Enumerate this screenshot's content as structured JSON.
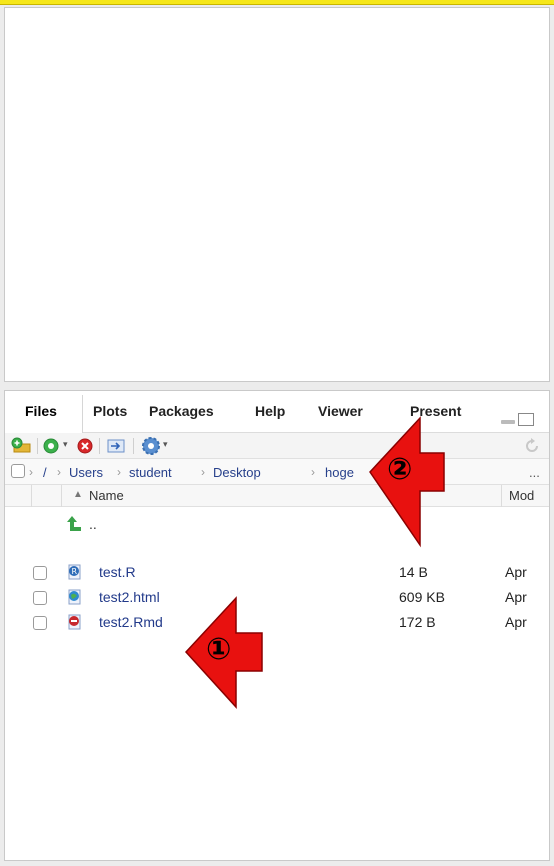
{
  "tabs": [
    {
      "label": "Files"
    },
    {
      "label": "Plots"
    },
    {
      "label": "Packages"
    },
    {
      "label": "Help"
    },
    {
      "label": "Viewer"
    },
    {
      "label": "Present"
    }
  ],
  "toolbar": {
    "icons": [
      "new-folder-icon",
      "add-file-icon",
      "delete-icon",
      "rename-icon",
      "more-gear-icon",
      "refresh-icon"
    ]
  },
  "path": {
    "root": "/",
    "crumbs": [
      "Users",
      "student",
      "Desktop",
      "hoge"
    ],
    "ellipsis": "..."
  },
  "columns": {
    "sort_arrow": "▲",
    "name": "Name",
    "modified": "Mod"
  },
  "parent_row": {
    "label": ".."
  },
  "files": [
    {
      "name": "test.R",
      "size": "14 B",
      "modified": "Apr"
    },
    {
      "name": "test2.html",
      "size": "609 KB",
      "modified": "Apr"
    },
    {
      "name": "test2.Rmd",
      "size": "172 B",
      "modified": "Apr"
    }
  ],
  "annotations": {
    "callout1": "①",
    "callout2": "②",
    "arrow_color": "#e8110f"
  }
}
